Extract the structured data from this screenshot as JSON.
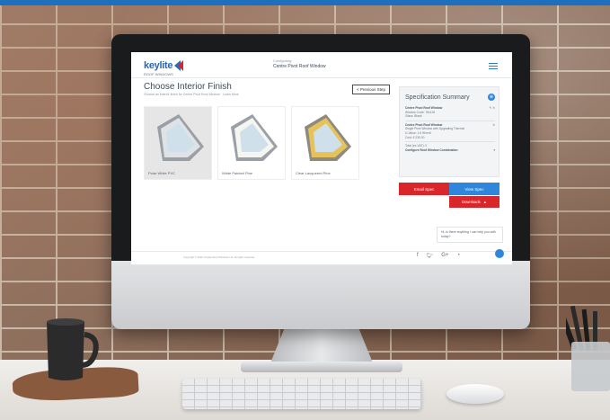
{
  "app": {
    "logo_text": "keylite",
    "logo_sub": "ROOF WINDOWS",
    "config_small": "Configuring",
    "config_title": "Centre Pivot Roof Window"
  },
  "page": {
    "title": "Choose Interior Finish",
    "subtitle": "Choose an interior finish for Centre Pivot Roof Window · Learn More",
    "prev_button": "< Previous Step"
  },
  "finishes": [
    {
      "label": "Polar White PVC",
      "frame_color": "#dfe3e6",
      "selected": true
    },
    {
      "label": "White Painted Pine",
      "frame_color": "#f5f5f2",
      "selected": false
    },
    {
      "label": "Clear Lacquered Pine",
      "frame_color": "#e6c25a",
      "selected": false
    }
  ],
  "spec": {
    "title": "Specification Summary",
    "rows": [
      {
        "name": "Centre Pivot Roof Window",
        "value": ""
      },
      {
        "name": "Window Code: 78x118",
        "value": ""
      },
      {
        "name": "Glass: Blank",
        "value": ""
      },
      {
        "name": "Centre Pivot Roof Window",
        "value": ""
      },
      {
        "name": "Single Pivot Window with Upgrading Thermal",
        "value": ""
      },
      {
        "name": "U-Value: 1.6 W/m²K",
        "value": ""
      },
      {
        "name": "Cost: £ 230.00",
        "value": ""
      },
      {
        "name": "Total (ex-VAT): 0",
        "value": ""
      },
      {
        "name": "Configure Roof Window Combination",
        "value": ""
      }
    ],
    "btn_email": "Email Spec",
    "btn_view": "View Spec",
    "btn_downloads": "Downloads"
  },
  "chat": {
    "text": "Hi, is there anything I can help you with today?"
  },
  "footer": {
    "text": "Copyright © 2016. Keylite Roof Windows Ltd. All rights reserved.",
    "social": [
      "f",
      "t",
      "G+",
      "rss"
    ]
  },
  "colors": {
    "brand_blue": "#2f86da",
    "brand_red": "#d9262b"
  }
}
